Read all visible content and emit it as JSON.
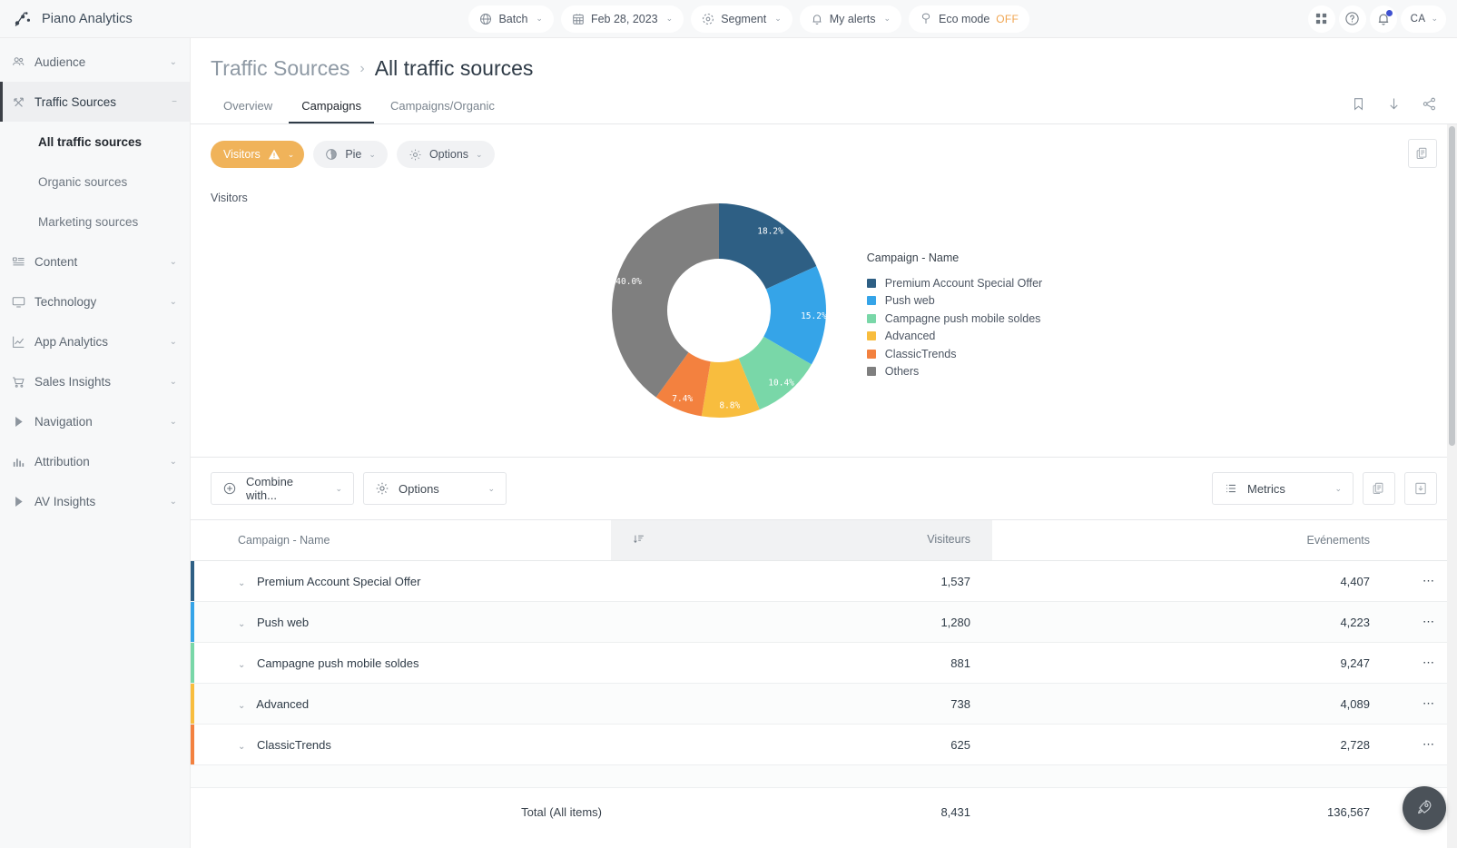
{
  "brand": {
    "name": "Piano Analytics",
    "logo_icon": "piano-analytics-logo"
  },
  "topbar": {
    "pills": [
      {
        "label": "Batch",
        "icon": "globe-icon",
        "chevron": "⌄"
      },
      {
        "label": "Feb 28, 2023",
        "icon": "calendar-icon",
        "chevron": "⌄"
      },
      {
        "label": "Segment",
        "icon": "segment-target-icon",
        "chevron": "⌄"
      },
      {
        "label": "My alerts",
        "icon": "bell-icon",
        "chevron": "⌄"
      }
    ],
    "eco": {
      "label": "Eco mode",
      "state": "OFF",
      "icon": "eco-leaf-icon",
      "state_color": "#f0a550"
    },
    "right": {
      "apps_icon": "grid-apps-icon",
      "help_icon": "help-circle-icon",
      "notifications_icon": "bell-icon",
      "has_notification": true,
      "avatar_initials": "CA",
      "avatar_chevron": "⌄"
    }
  },
  "sidebar": {
    "items": [
      {
        "label": "Audience",
        "icon": "people-icon",
        "chevron": "⌄",
        "active": false
      },
      {
        "label": "Traffic Sources",
        "icon": "arrows-exchange-icon",
        "chevron": "−",
        "active": true
      },
      {
        "label": "Content",
        "icon": "content-list-icon",
        "chevron": "⌄",
        "active": false
      },
      {
        "label": "Technology",
        "icon": "monitor-icon",
        "chevron": "⌄",
        "active": false
      },
      {
        "label": "App Analytics",
        "icon": "line-chart-icon",
        "chevron": "⌄",
        "active": false
      },
      {
        "label": "Sales Insights",
        "icon": "shopping-cart-icon",
        "chevron": "⌄",
        "active": false
      },
      {
        "label": "Navigation",
        "icon": "play-triangle-icon",
        "chevron": "⌄",
        "active": false
      },
      {
        "label": "Attribution",
        "icon": "bar-chart-icon",
        "chevron": "⌄",
        "active": false
      },
      {
        "label": "AV Insights",
        "icon": "play-triangle-icon",
        "chevron": "⌄",
        "active": false
      }
    ],
    "sub_items": [
      {
        "label": "All traffic sources",
        "selected": true
      },
      {
        "label": "Organic sources",
        "selected": false
      },
      {
        "label": "Marketing sources",
        "selected": false
      }
    ]
  },
  "page": {
    "breadcrumb_parent": "Traffic Sources",
    "breadcrumb_sep": "›",
    "breadcrumb_current": "All traffic sources",
    "actions": [
      {
        "name": "bookmark-icon"
      },
      {
        "name": "download-icon"
      },
      {
        "name": "share-icon"
      }
    ],
    "tabs": [
      {
        "label": "Overview",
        "active": false
      },
      {
        "label": "Campaigns",
        "active": true
      },
      {
        "label": "Campaigns/Organic",
        "active": false
      }
    ]
  },
  "chart_toolbar": {
    "metric": {
      "label": "Visitors",
      "warning_icon": "warning-triangle-icon",
      "chevron": "⌄",
      "color": "#f0b35a"
    },
    "type": {
      "label": "Pie",
      "icon": "pie-chart-icon",
      "chevron": "⌄"
    },
    "options": {
      "label": "Options",
      "icon": "gear-icon",
      "chevron": "⌄"
    },
    "corner_button_icon": "duplicate-pages-icon"
  },
  "chart_caption": "Visitors",
  "chart_data": {
    "type": "pie",
    "variant": "donut",
    "title": "Visitors",
    "legend_title": "Campaign - Name",
    "legend_position": "right",
    "categories": [
      "Premium Account Special Offer",
      "Push web",
      "Campagne push mobile soldes",
      "Advanced",
      "ClassicTrends",
      "Others"
    ],
    "values": [
      18.2,
      15.2,
      10.4,
      8.8,
      7.4,
      40.0
    ],
    "value_labels": [
      "18.2%",
      "15.2%",
      "10.4%",
      "8.8%",
      "7.4%",
      "40.0%"
    ],
    "colors": [
      "#2e5f84",
      "#35a4e8",
      "#79d7a8",
      "#f8bd3e",
      "#f3813f",
      "#7f7f7f"
    ],
    "unit": "%"
  },
  "table_toolbar": {
    "combine": {
      "label": "Combine with...",
      "icon": "plus-circle-icon",
      "chevron": "⌄"
    },
    "options": {
      "label": "Options",
      "icon": "gear-icon",
      "chevron": "⌄"
    },
    "metrics": {
      "label": "Metrics",
      "icon": "list-icon",
      "chevron": "⌄"
    },
    "icon_buttons": [
      {
        "name": "duplicate-pages-icon"
      },
      {
        "name": "export-document-icon"
      }
    ]
  },
  "table": {
    "columns": [
      {
        "label": "Campaign - Name",
        "align": "left",
        "sorted": false
      },
      {
        "label": "Visiteurs",
        "align": "right",
        "sorted": true,
        "sort_icon": "sort-descending-icon"
      },
      {
        "label": "Evénements",
        "align": "right",
        "sorted": false
      }
    ],
    "rows": [
      {
        "name": "Premium Account Special Offer",
        "visiteurs": "1,537",
        "evenements": "4,407",
        "color": "#2e5f84",
        "chevron": "⌄",
        "actions": "⋯"
      },
      {
        "name": "Push web",
        "visiteurs": "1,280",
        "evenements": "4,223",
        "color": "#35a4e8",
        "chevron": "⌄",
        "actions": "⋯"
      },
      {
        "name": "Campagne push mobile soldes",
        "visiteurs": "881",
        "evenements": "9,247",
        "color": "#79d7a8",
        "chevron": "⌄",
        "actions": "⋯"
      },
      {
        "name": "Advanced",
        "visiteurs": "738",
        "evenements": "4,089",
        "color": "#f8bd3e",
        "chevron": "⌄",
        "actions": "⋯"
      },
      {
        "name": "ClassicTrends",
        "visiteurs": "625",
        "evenements": "2,728",
        "color": "#f3813f",
        "chevron": "⌄",
        "actions": "⋯"
      }
    ],
    "total": {
      "label": "Total (All items)",
      "visiteurs": "8,431",
      "evenements": "136,567"
    }
  },
  "fab": {
    "icon": "rocket-icon"
  }
}
